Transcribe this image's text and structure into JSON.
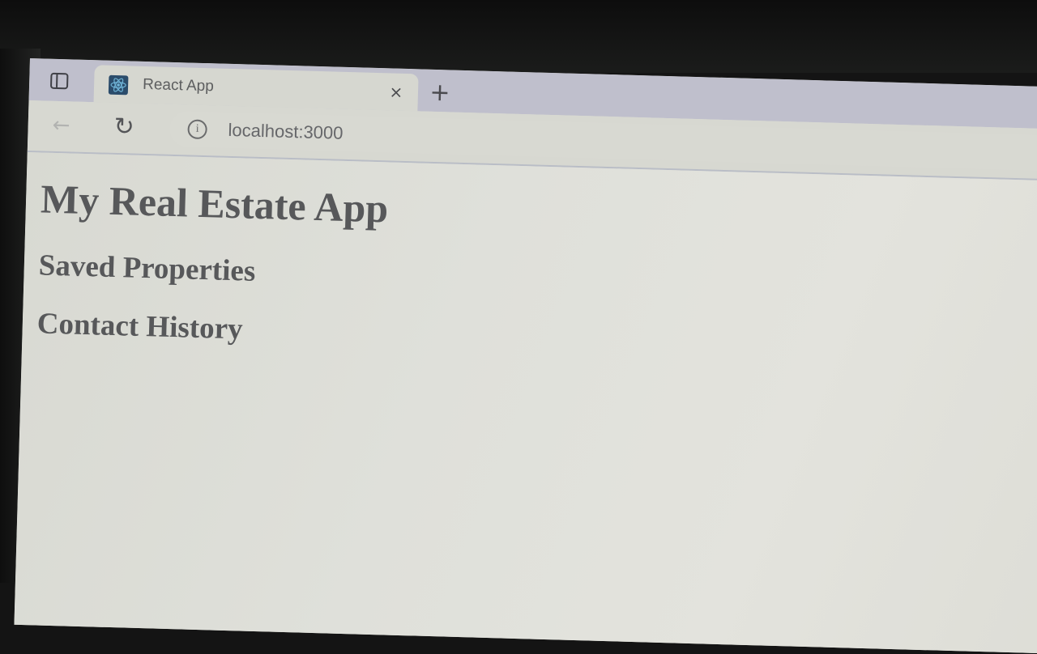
{
  "browser": {
    "tab": {
      "title": "React App",
      "close_glyph": "×",
      "favicon_icon": "react-favicon-icon"
    },
    "new_tab_glyph": "+",
    "toolbar": {
      "back_glyph": "←",
      "reload_glyph": "↻",
      "info_glyph": "i",
      "url": "localhost:3000"
    }
  },
  "page": {
    "title": "My Real Estate App",
    "sections": [
      {
        "heading": "Saved Properties"
      },
      {
        "heading": "Contact History"
      }
    ]
  }
}
